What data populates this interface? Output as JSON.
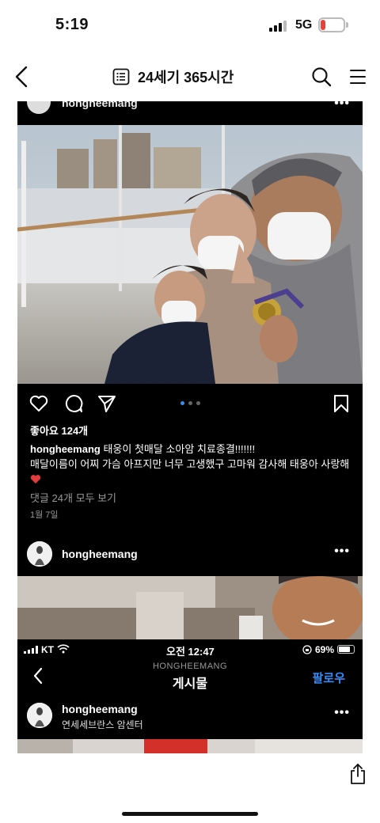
{
  "status_bar": {
    "time": "5:19",
    "network": "5G",
    "battery": "20",
    "battery_level": 0.2,
    "battery_color": "#e8403a"
  },
  "nav": {
    "title": "24세기 365시간",
    "icons": [
      "back-icon",
      "document-list-icon",
      "search-icon",
      "menu-icon"
    ]
  },
  "screenshot1": {
    "top_username": "hongheemang",
    "more": "•••",
    "carousel": {
      "total": 3,
      "active": 1,
      "active_color": "#3a8bf5"
    },
    "likes": "좋아요 124개",
    "caption_user": "hongheemang",
    "caption_line1": "태웅이 첫매달 소아암 치료종결!!!!!!!",
    "caption_line2": "매달이름이 어찌 가슴 아프지만 너무 고생했구 고마워 감사해 태웅아 사랑해",
    "view_comments": "댓글 24개 모두 보기",
    "date": "1월 7일",
    "next_post": {
      "username": "hongheemang",
      "more": "•••"
    }
  },
  "screenshot2": {
    "carrier": "KT",
    "time": "오전 12:47",
    "battery": "69%",
    "header_username": "HONGHEEMANG",
    "header_title": "게시물",
    "follow": "팔로우",
    "post": {
      "username": "hongheemang",
      "location": "연세세브란스 암센터",
      "more": "•••"
    }
  },
  "toolbar": {
    "icons": [
      "share-icon"
    ]
  }
}
